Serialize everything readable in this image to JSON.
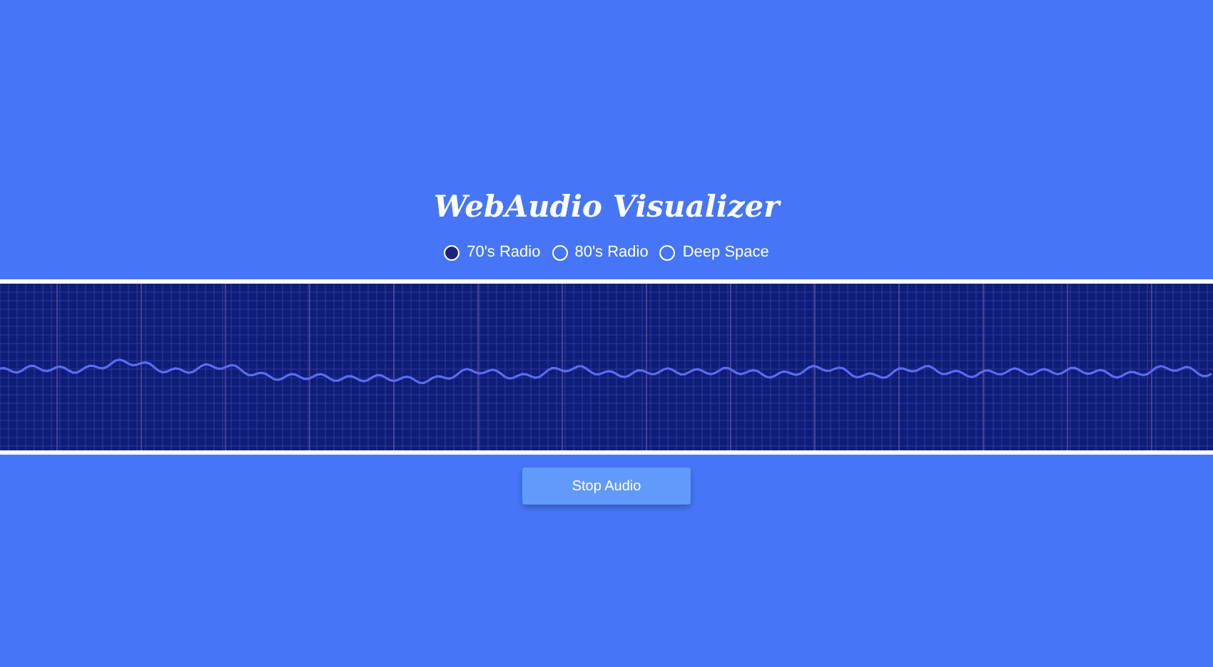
{
  "title": "WebAudio Visualizer",
  "themes": [
    {
      "label": "70's Radio",
      "selected": true
    },
    {
      "label": "80's Radio",
      "selected": false
    },
    {
      "label": "Deep Space",
      "selected": false
    }
  ],
  "button": "Stop Audio"
}
